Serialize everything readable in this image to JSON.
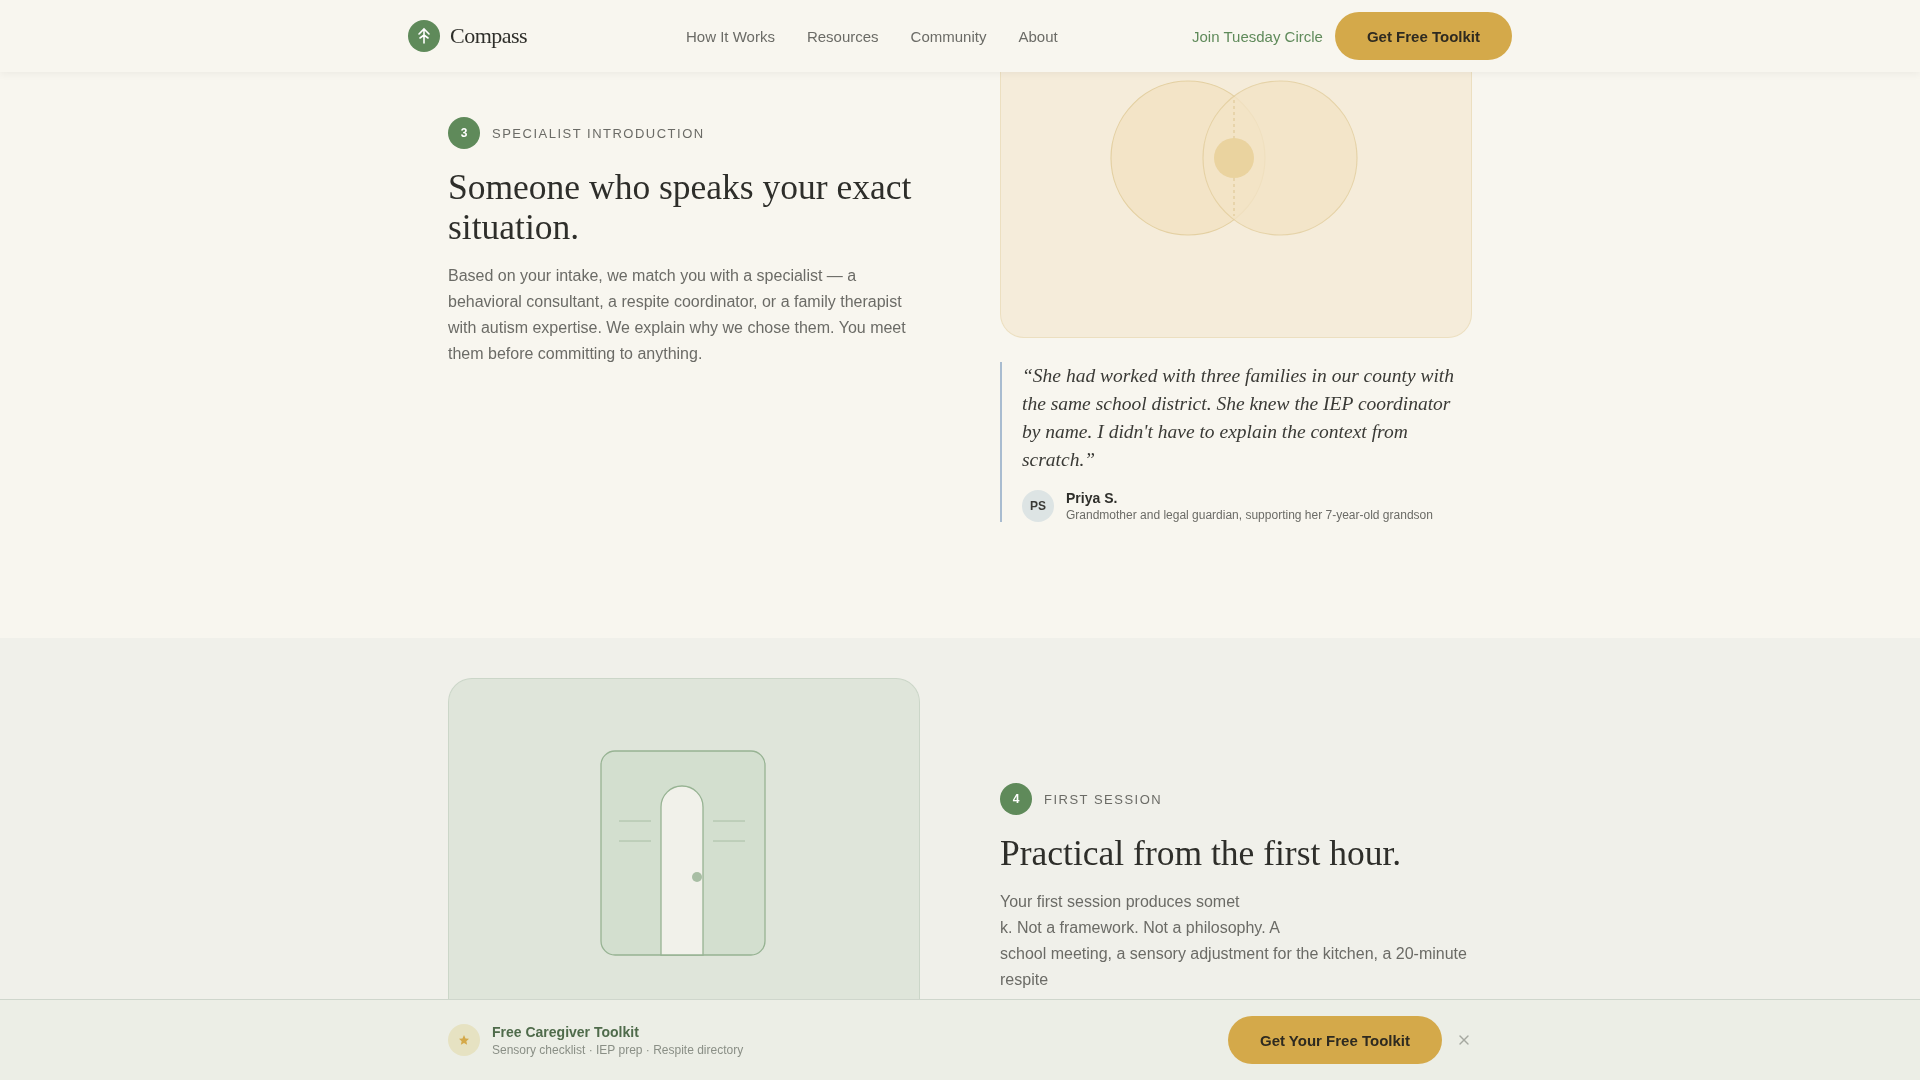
{
  "header": {
    "logo": "Compass",
    "nav": [
      {
        "label": "How It Works"
      },
      {
        "label": "Resources"
      },
      {
        "label": "Community"
      },
      {
        "label": "About"
      }
    ],
    "link": "Join Tuesday Circle",
    "button": "Get Free Toolkit"
  },
  "steps": [
    {
      "number": "3",
      "eyebrow": "SPECIALIST INTRODUCTION",
      "heading": "Someone who speaks your exact situation.",
      "body": [
        "Based on your intake, we match you with a specialist — a behavioral consultant, a respite coordinator, or a family therapist with autism expertise. We explain why we chose them. You meet them before committing to anything."
      ],
      "kind": "circles",
      "quote": {
        "text": "“She had worked with three families in our county with the same school district. She knew the IEP coordinator by name. I didn't have to explain the context from scratch.”",
        "initials": "PS",
        "name": "Priya S.",
        "role": "Grandmother and legal guardian, supporting her 7-year-old grandson"
      }
    },
    {
      "number": "4",
      "eyebrow": "FIRST SESSION",
      "heading": "Practical from the first hour.",
      "body": [
        "Your first session produces somet",
        "k. Not a framework. Not a philosophy. A",
        "school meeting, a sensory adjustment for the kitchen, a 20-minute respite"
      ],
      "kind": "door"
    }
  ],
  "bottom_bar": {
    "title": "Free Caregiver Toolkit",
    "subtitle": "Sensory checklist · IEP prep · Respite directory",
    "button": "Get Your Free Toolkit"
  }
}
